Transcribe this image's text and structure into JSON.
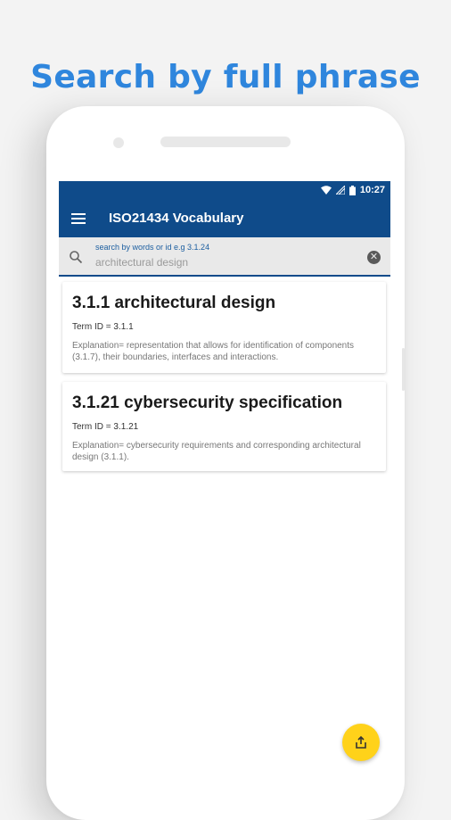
{
  "headline": "Search by full phrase",
  "status_bar": {
    "time": "10:27"
  },
  "app_bar": {
    "title": "ISO21434 Vocabulary"
  },
  "search": {
    "hint": "search by words or id e.g 3.1.24",
    "value": "architectural design"
  },
  "results": [
    {
      "title": "3.1.1 architectural design",
      "term_id": "Term ID = 3.1.1",
      "explanation": "Explanation= representation that allows for identification of components (3.1.7), their boundaries, interfaces and interactions."
    },
    {
      "title": "3.1.21 cybersecurity specification",
      "term_id": "Term ID = 3.1.21",
      "explanation": "Explanation= cybersecurity requirements and corresponding architectural design (3.1.1)."
    }
  ],
  "icons": {
    "menu": "menu-icon",
    "search": "search-icon",
    "clear": "clear-icon",
    "share": "share-icon",
    "wifi": "wifi-icon",
    "signal": "signal-icon",
    "battery": "battery-icon"
  },
  "colors": {
    "primary": "#0f4b8a",
    "headline": "#2f86dd",
    "fab": "#ffd21a"
  }
}
